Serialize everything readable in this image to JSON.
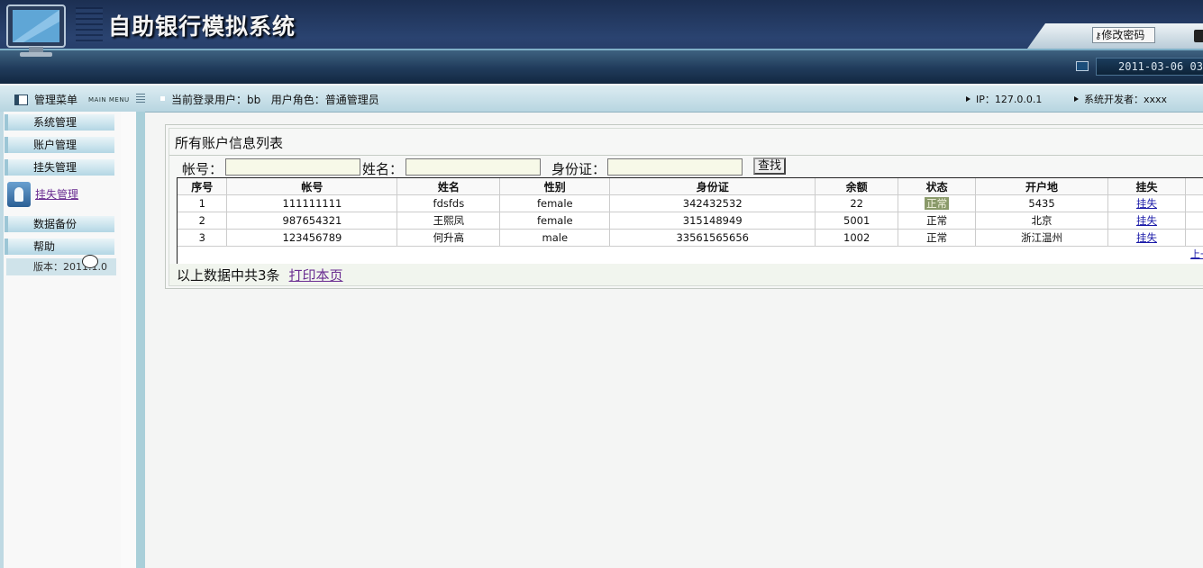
{
  "header": {
    "app_title": "自助银行模拟系统",
    "change_password_label": "修改密码",
    "datetime": "2011-03-06 03"
  },
  "infobar": {
    "menu_title": "管理菜单",
    "menu_title_en": "MAIN MENU",
    "current_user_label": "当前登录用户：bb",
    "user_role_label": "用户角色：普通管理员",
    "ip_label": "IP：127.0.0.1",
    "developer_label": "系统开发者：xxxx"
  },
  "sidebar": {
    "items": [
      {
        "label": "系统管理"
      },
      {
        "label": "账户管理"
      },
      {
        "label": "挂失管理"
      },
      {
        "label": "数据备份"
      },
      {
        "label": "帮助"
      }
    ],
    "active_sub_item": "挂失管理",
    "version": "版本：2011.1.0"
  },
  "main": {
    "panel_title": "所有账户信息列表",
    "search": {
      "account_label": "帐号：",
      "name_label": "姓名：",
      "id_label": "身份证：",
      "search_button": "查找"
    },
    "table": {
      "columns": [
        "序号",
        "帐号",
        "姓名",
        "性别",
        "身份证",
        "余额",
        "状态",
        "开户地",
        "挂失"
      ],
      "rows": [
        [
          "1",
          "111111111",
          "fdsfds",
          "female",
          "342432532",
          "22",
          "正常",
          "5435",
          "挂失"
        ],
        [
          "2",
          "987654321",
          "王熙凤",
          "female",
          "315148949",
          "5001",
          "正常",
          "北京",
          "挂失"
        ],
        [
          "3",
          "123456789",
          "何升高",
          "male",
          "33561565656",
          "1002",
          "正常",
          "浙江温州",
          "挂失"
        ]
      ],
      "pager_label": "上一"
    },
    "summary_text": "以上数据中共3条",
    "print_link": "打印本页"
  }
}
